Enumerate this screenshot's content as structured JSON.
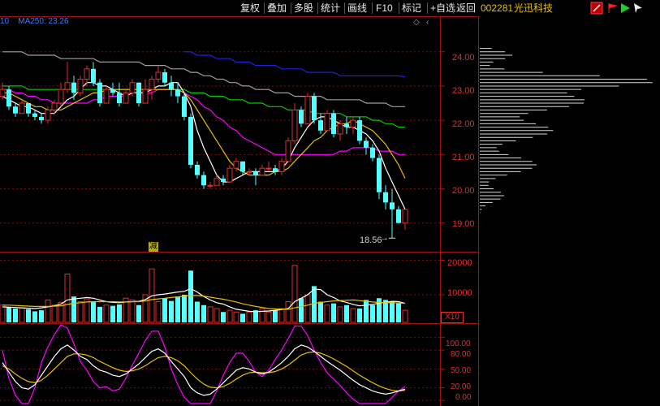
{
  "toolbar": {
    "items": [
      "复权",
      "叠加",
      "多股",
      "统计",
      "画线",
      "F10",
      "标记",
      "+自选",
      "返回"
    ]
  },
  "stock": {
    "code": "002281",
    "name": "光迅科技"
  },
  "ma_label": "10    MA250: 23.26",
  "colors": {
    "up": "#e03030",
    "down": "#54ffff",
    "ma5": "#ffffff",
    "ma10": "#e8c000",
    "ma20": "#ff00ff",
    "ma60": "#00cc00",
    "ma120": "#a0a0a0",
    "ma250": "#2020e0"
  },
  "price_axis": {
    "ticks": [
      "24.00",
      "23.00",
      "22.00",
      "21.00",
      "20.00",
      "19.00"
    ]
  },
  "volume_axis": {
    "ticks": [
      "20000",
      "10000"
    ],
    "unit": "X10"
  },
  "kdj_axis": {
    "ticks": [
      "100.00",
      "80.00",
      "50.00",
      "20.00",
      "0.00"
    ]
  },
  "annotations": {
    "low_price": "18.56",
    "reduce_mark": "减"
  },
  "chart_data": {
    "type": "candlestick",
    "ylim": [
      18.4,
      24.8
    ],
    "candles": [
      [
        22.7,
        23.1,
        22.6,
        22.9
      ],
      [
        22.9,
        23.0,
        22.3,
        22.4
      ],
      [
        22.4,
        22.5,
        22.1,
        22.2
      ],
      [
        22.2,
        22.6,
        22.2,
        22.5
      ],
      [
        22.5,
        22.5,
        22.1,
        22.2
      ],
      [
        22.2,
        22.3,
        22.0,
        22.1
      ],
      [
        22.1,
        22.2,
        21.9,
        22.0
      ],
      [
        22.0,
        22.4,
        21.9,
        22.3
      ],
      [
        22.3,
        22.6,
        22.2,
        22.5
      ],
      [
        22.5,
        23.1,
        22.4,
        22.9
      ],
      [
        22.9,
        23.7,
        22.8,
        23.1
      ],
      [
        23.1,
        23.3,
        22.6,
        22.8
      ],
      [
        22.8,
        23.3,
        22.7,
        23.2
      ],
      [
        23.2,
        23.6,
        23.0,
        23.5
      ],
      [
        23.5,
        23.7,
        23.0,
        23.1
      ],
      [
        23.1,
        23.2,
        22.4,
        22.5
      ],
      [
        22.5,
        23.0,
        22.5,
        22.9
      ],
      [
        22.9,
        23.1,
        22.7,
        22.8
      ],
      [
        22.8,
        23.1,
        22.4,
        22.5
      ],
      [
        22.5,
        22.9,
        22.5,
        22.8
      ],
      [
        22.8,
        23.2,
        22.7,
        23.1
      ],
      [
        23.1,
        23.1,
        22.4,
        22.5
      ],
      [
        22.5,
        23.2,
        22.5,
        22.9
      ],
      [
        22.9,
        23.3,
        22.6,
        23.2
      ],
      [
        23.2,
        23.6,
        23.1,
        23.4
      ],
      [
        23.4,
        23.5,
        23.0,
        23.1
      ],
      [
        23.1,
        23.3,
        22.7,
        22.9
      ],
      [
        22.9,
        23.1,
        22.5,
        22.7
      ],
      [
        22.7,
        22.8,
        22.0,
        22.1
      ],
      [
        22.1,
        22.2,
        20.6,
        20.7
      ],
      [
        20.7,
        20.8,
        20.3,
        20.4
      ],
      [
        20.4,
        20.5,
        20.0,
        20.1
      ],
      [
        20.1,
        20.2,
        20.0,
        20.1
      ],
      [
        20.1,
        20.4,
        20.1,
        20.3
      ],
      [
        20.3,
        20.4,
        20.1,
        20.2
      ],
      [
        20.2,
        20.7,
        20.2,
        20.6
      ],
      [
        20.6,
        20.9,
        20.5,
        20.8
      ],
      [
        20.8,
        20.8,
        20.4,
        20.5
      ],
      [
        20.5,
        20.6,
        20.4,
        20.5
      ],
      [
        20.5,
        20.6,
        20.1,
        20.4
      ],
      [
        20.4,
        20.7,
        20.4,
        20.6
      ],
      [
        20.6,
        20.8,
        20.5,
        20.6
      ],
      [
        20.6,
        20.7,
        20.4,
        20.5
      ],
      [
        20.5,
        20.9,
        20.4,
        20.8
      ],
      [
        20.8,
        21.5,
        20.8,
        21.4
      ],
      [
        21.4,
        22.5,
        21.3,
        22.3
      ],
      [
        22.3,
        22.4,
        21.8,
        21.9
      ],
      [
        21.9,
        22.8,
        21.9,
        22.7
      ],
      [
        22.7,
        22.8,
        21.9,
        22.0
      ],
      [
        22.0,
        22.2,
        21.6,
        21.7
      ],
      [
        21.7,
        22.3,
        21.7,
        22.2
      ],
      [
        22.2,
        22.3,
        21.5,
        21.6
      ],
      [
        21.6,
        22.0,
        21.4,
        21.9
      ],
      [
        21.9,
        22.1,
        21.6,
        21.8
      ],
      [
        21.8,
        22.1,
        21.6,
        22.0
      ],
      [
        22.0,
        22.1,
        21.3,
        21.4
      ],
      [
        21.4,
        21.5,
        21.0,
        21.2
      ],
      [
        21.2,
        21.3,
        20.8,
        20.9
      ],
      [
        20.9,
        21.0,
        19.7,
        19.9
      ],
      [
        19.9,
        20.1,
        19.4,
        19.6
      ],
      [
        19.6,
        20.0,
        18.56,
        19.4
      ],
      [
        19.4,
        19.5,
        19.1,
        19.0
      ],
      [
        19.0,
        19.4,
        18.8,
        19.4
      ]
    ],
    "ma5": [
      22.7,
      22.6,
      22.5,
      22.4,
      22.4,
      22.3,
      22.2,
      22.2,
      22.2,
      22.4,
      22.6,
      22.7,
      22.9,
      23.1,
      23.1,
      23.0,
      23.0,
      22.9,
      22.8,
      22.7,
      22.8,
      22.8,
      22.8,
      22.9,
      23.0,
      23.0,
      23.1,
      23.1,
      22.8,
      22.4,
      21.7,
      21.2,
      20.8,
      20.4,
      20.2,
      20.2,
      20.3,
      20.4,
      20.5,
      20.5,
      20.5,
      20.5,
      20.5,
      20.6,
      20.8,
      21.2,
      21.5,
      21.8,
      22.0,
      22.1,
      22.1,
      22.0,
      21.9,
      21.8,
      21.8,
      21.7,
      21.6,
      21.4,
      21.1,
      20.6,
      20.2,
      19.8,
      19.4
    ],
    "ma10": [
      22.8,
      22.8,
      22.7,
      22.6,
      22.5,
      22.4,
      22.4,
      22.3,
      22.3,
      22.3,
      22.4,
      22.5,
      22.6,
      22.7,
      22.8,
      22.8,
      22.9,
      22.9,
      22.9,
      22.9,
      22.9,
      22.9,
      22.9,
      22.9,
      22.9,
      22.9,
      22.9,
      22.9,
      22.8,
      22.6,
      22.3,
      22.0,
      21.7,
      21.4,
      21.1,
      20.8,
      20.6,
      20.5,
      20.4,
      20.4,
      20.4,
      20.4,
      20.5,
      20.5,
      20.6,
      20.8,
      21.0,
      21.2,
      21.4,
      21.5,
      21.7,
      21.8,
      21.9,
      21.9,
      22.0,
      21.9,
      21.8,
      21.7,
      21.5,
      21.3,
      21.0,
      20.7,
      20.3
    ],
    "ma20": [
      22.9,
      22.9,
      22.8,
      22.8,
      22.7,
      22.7,
      22.6,
      22.6,
      22.5,
      22.5,
      22.5,
      22.5,
      22.5,
      22.5,
      22.6,
      22.6,
      22.7,
      22.7,
      22.7,
      22.7,
      22.8,
      22.8,
      22.8,
      22.8,
      22.9,
      22.9,
      22.9,
      22.9,
      22.8,
      22.7,
      22.6,
      22.4,
      22.3,
      22.1,
      22.0,
      21.8,
      21.7,
      21.5,
      21.4,
      21.3,
      21.2,
      21.1,
      21.0,
      21.0,
      21.0,
      21.0,
      21.0,
      21.0,
      21.0,
      21.0,
      21.0,
      21.0,
      21.1,
      21.1,
      21.2,
      21.2,
      21.2,
      21.2,
      21.1,
      21.1,
      21.1,
      21.0,
      21.0
    ],
    "ma60": [
      23.0,
      23.0,
      23.0,
      23.0,
      22.9,
      22.9,
      22.9,
      22.9,
      22.9,
      22.9,
      22.9,
      22.9,
      22.9,
      22.9,
      22.9,
      22.9,
      22.9,
      22.9,
      22.9,
      22.9,
      22.9,
      22.9,
      22.9,
      22.9,
      22.9,
      22.9,
      22.9,
      22.9,
      22.9,
      22.8,
      22.8,
      22.8,
      22.7,
      22.7,
      22.7,
      22.6,
      22.6,
      22.6,
      22.5,
      22.5,
      22.5,
      22.4,
      22.4,
      22.4,
      22.3,
      22.3,
      22.3,
      22.3,
      22.2,
      22.2,
      22.2,
      22.2,
      22.2,
      22.1,
      22.1,
      22.1,
      22.1,
      22.0,
      22.0,
      21.9,
      21.9,
      21.8,
      21.8
    ],
    "ma120": [
      24.0,
      24.0,
      24.0,
      24.0,
      23.9,
      23.9,
      23.9,
      23.9,
      23.9,
      23.8,
      23.8,
      23.8,
      23.8,
      23.8,
      23.8,
      23.7,
      23.7,
      23.7,
      23.7,
      23.7,
      23.7,
      23.7,
      23.6,
      23.6,
      23.6,
      23.6,
      23.5,
      23.5,
      23.5,
      23.4,
      23.4,
      23.3,
      23.3,
      23.2,
      23.2,
      23.1,
      23.1,
      23.0,
      23.0,
      22.9,
      22.9,
      22.9,
      22.8,
      22.8,
      22.8,
      22.7,
      22.7,
      22.7,
      22.7,
      22.7,
      22.6,
      22.6,
      22.6,
      22.6,
      22.6,
      22.6,
      22.5,
      22.5,
      22.5,
      22.5,
      22.4,
      22.4,
      22.4
    ],
    "ma250": [
      null,
      null,
      null,
      null,
      null,
      null,
      null,
      null,
      null,
      null,
      null,
      null,
      null,
      null,
      null,
      null,
      null,
      null,
      null,
      null,
      null,
      null,
      null,
      null,
      null,
      null,
      null,
      null,
      24.0,
      24.0,
      23.9,
      23.9,
      23.9,
      23.8,
      23.8,
      23.8,
      23.7,
      23.7,
      23.7,
      23.6,
      23.6,
      23.6,
      23.6,
      23.5,
      23.5,
      23.5,
      23.5,
      23.4,
      23.4,
      23.4,
      23.4,
      23.4,
      23.3,
      23.3,
      23.3,
      23.3,
      23.3,
      23.3,
      23.3,
      23.3,
      23.3,
      23.3,
      23.26
    ],
    "volume_ylim": [
      2000,
      22000
    ],
    "volume": [
      7000,
      6500,
      6000,
      6200,
      5800,
      5200,
      5500,
      8500,
      7000,
      7800,
      16000,
      9500,
      8000,
      8800,
      8000,
      6500,
      7000,
      6800,
      7200,
      9000,
      8500,
      7000,
      10000,
      17500,
      8000,
      9000,
      8200,
      9500,
      10000,
      17000,
      8000,
      7000,
      6500,
      6000,
      5000,
      5500,
      5000,
      4500,
      5000,
      5500,
      6000,
      5000,
      5500,
      6000,
      8000,
      18500,
      9000,
      10000,
      12500,
      8000,
      7000,
      7500,
      6500,
      7000,
      6000,
      6000,
      8500,
      7000,
      9000,
      8500,
      8000,
      7500,
      5500
    ],
    "vol_ma1": [
      6500,
      6400,
      6300,
      6200,
      6100,
      6000,
      6200,
      6500,
      6800,
      7300,
      8500,
      8800,
      9000,
      9200,
      9000,
      8500,
      8000,
      7800,
      7700,
      7900,
      8000,
      8100,
      8600,
      9700,
      10000,
      10200,
      10500,
      10800,
      11000,
      11800,
      10800,
      9500,
      8500,
      7700,
      7300,
      6500,
      5800,
      5500,
      5200,
      5100,
      5200,
      5300,
      5500,
      5700,
      6000,
      8000,
      9000,
      10000,
      11600,
      11500,
      10000,
      9200,
      8200,
      7800,
      7200,
      6800,
      7000,
      7200,
      7600,
      7800,
      8100,
      8000,
      7500
    ],
    "vol_ma2": [
      7000,
      7000,
      6900,
      6800,
      6700,
      6600,
      6600,
      6600,
      6700,
      6800,
      7200,
      7500,
      7700,
      7900,
      8000,
      8000,
      8000,
      8000,
      7900,
      7900,
      8000,
      8000,
      8200,
      8600,
      8800,
      9000,
      9200,
      9400,
      9600,
      9800,
      9800,
      9600,
      9300,
      9000,
      8700,
      8300,
      7900,
      7400,
      7000,
      6600,
      6300,
      6000,
      5900,
      5800,
      5800,
      6200,
      6600,
      7000,
      7500,
      7800,
      8000,
      8200,
      8300,
      8400,
      8500,
      8300,
      8100,
      7900,
      7800,
      7700,
      7700,
      7600,
      7500
    ],
    "kdj_ylim": [
      -5,
      115
    ],
    "kdj_k": [
      60,
      45,
      30,
      20,
      18,
      25,
      40,
      55,
      70,
      82,
      88,
      80,
      70,
      65,
      55,
      48,
      45,
      40,
      38,
      42,
      50,
      58,
      68,
      78,
      82,
      75,
      62,
      50,
      38,
      20,
      12,
      8,
      10,
      18,
      28,
      38,
      48,
      52,
      50,
      45,
      42,
      45,
      52,
      60,
      70,
      82,
      88,
      85,
      78,
      70,
      62,
      55,
      48,
      40,
      32,
      25,
      20,
      15,
      12,
      10,
      12,
      15,
      18
    ],
    "kdj_d": [
      55,
      50,
      42,
      35,
      30,
      28,
      32,
      40,
      50,
      60,
      70,
      74,
      74,
      72,
      68,
      62,
      57,
      52,
      48,
      46,
      47,
      50,
      55,
      62,
      68,
      70,
      68,
      63,
      55,
      44,
      34,
      26,
      21,
      20,
      22,
      27,
      34,
      40,
      44,
      45,
      44,
      44,
      46,
      50,
      56,
      64,
      72,
      76,
      77,
      75,
      71,
      66,
      60,
      54,
      47,
      40,
      34,
      28,
      23,
      19,
      16,
      15,
      16
    ],
    "kdj_j": [
      80,
      35,
      8,
      -5,
      -5,
      20,
      60,
      85,
      105,
      120,
      115,
      90,
      62,
      48,
      30,
      20,
      22,
      15,
      18,
      35,
      56,
      75,
      95,
      110,
      110,
      85,
      50,
      25,
      5,
      -5,
      -5,
      -5,
      -5,
      15,
      40,
      60,
      75,
      75,
      62,
      45,
      38,
      48,
      65,
      80,
      98,
      118,
      118,
      103,
      80,
      60,
      44,
      34,
      24,
      12,
      2,
      -5,
      -5,
      -5,
      -5,
      -5,
      5,
      15,
      22
    ]
  }
}
